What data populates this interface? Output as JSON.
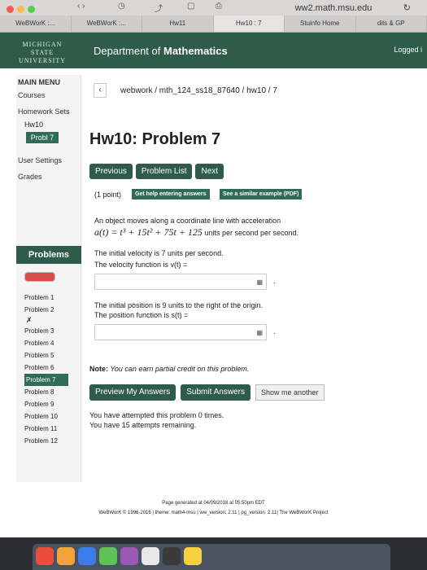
{
  "browser": {
    "url": "ww2.math.msu.edu",
    "tabs": [
      "WeBWorK :...",
      "WeBWorK :...",
      "Hw11",
      "Hw10 : 7",
      "Stuinfo Home",
      "dits & GP"
    ]
  },
  "header": {
    "logo_line1": "MICHIGAN STATE",
    "logo_line2": "UNIVERSITY",
    "dept_prefix": "Department of",
    "dept_bold": "Mathematics",
    "logged": "Logged i"
  },
  "sidebar": {
    "main_menu": "MAIN MENU",
    "courses": "Courses",
    "homework_sets": "Homework Sets",
    "hw": "Hw10",
    "active_problem": "Probl 7",
    "user_settings": "User Settings",
    "grades": "Grades",
    "problems_head": "Problems",
    "problems": [
      "Problem 1",
      "Problem 2",
      "Problem 3",
      "Problem 4",
      "Problem 5",
      "Problem 6",
      "Problem 7",
      "Problem 8",
      "Problem 9",
      "Problem 10",
      "Problem 11",
      "Problem 12"
    ],
    "x_mark": "✗"
  },
  "main": {
    "breadcrumb": "webwork / mth_124_ss18_87640 / hw10 / 7",
    "title": "Hw10: Problem 7",
    "btn_previous": "Previous",
    "btn_problem_list": "Problem List",
    "btn_next": "Next",
    "points": "(1 point)",
    "hint_entering": "Get help entering answers",
    "hint_similar": "See a similar example (PDF)",
    "text1": "An object moves along a coordinate line with acceleration",
    "accel_formula": "a(t) = t³ + 15t² + 75t + 125",
    "accel_units": "units per second per second.",
    "text2": "The initial velocity is 7 units per second.",
    "text3": "The velocity function is v(t) =",
    "text4": "The initial position is 9 units to the right of the origin.",
    "text5": "The position function is s(t) =",
    "note_label": "Note:",
    "note_text": " You can earn partial credit on this problem.",
    "btn_preview": "Preview My Answers",
    "btn_submit": "Submit Answers",
    "btn_show": "Show me another",
    "attempts1": "You have attempted this problem 0 times.",
    "attempts2": "You have 15 attempts remaining."
  },
  "footer": {
    "line1": "Page generated at 04/09/2018 at 05:50pm EDT",
    "line2": "WeBWorK © 1996-2016 | theme: math4-msu | ww_version: 2.11 | pg_version: 2.11| The WeBWorK Project"
  },
  "colors": {
    "header_green": "#2f5b4b",
    "progress_red": "#d94d4d"
  }
}
